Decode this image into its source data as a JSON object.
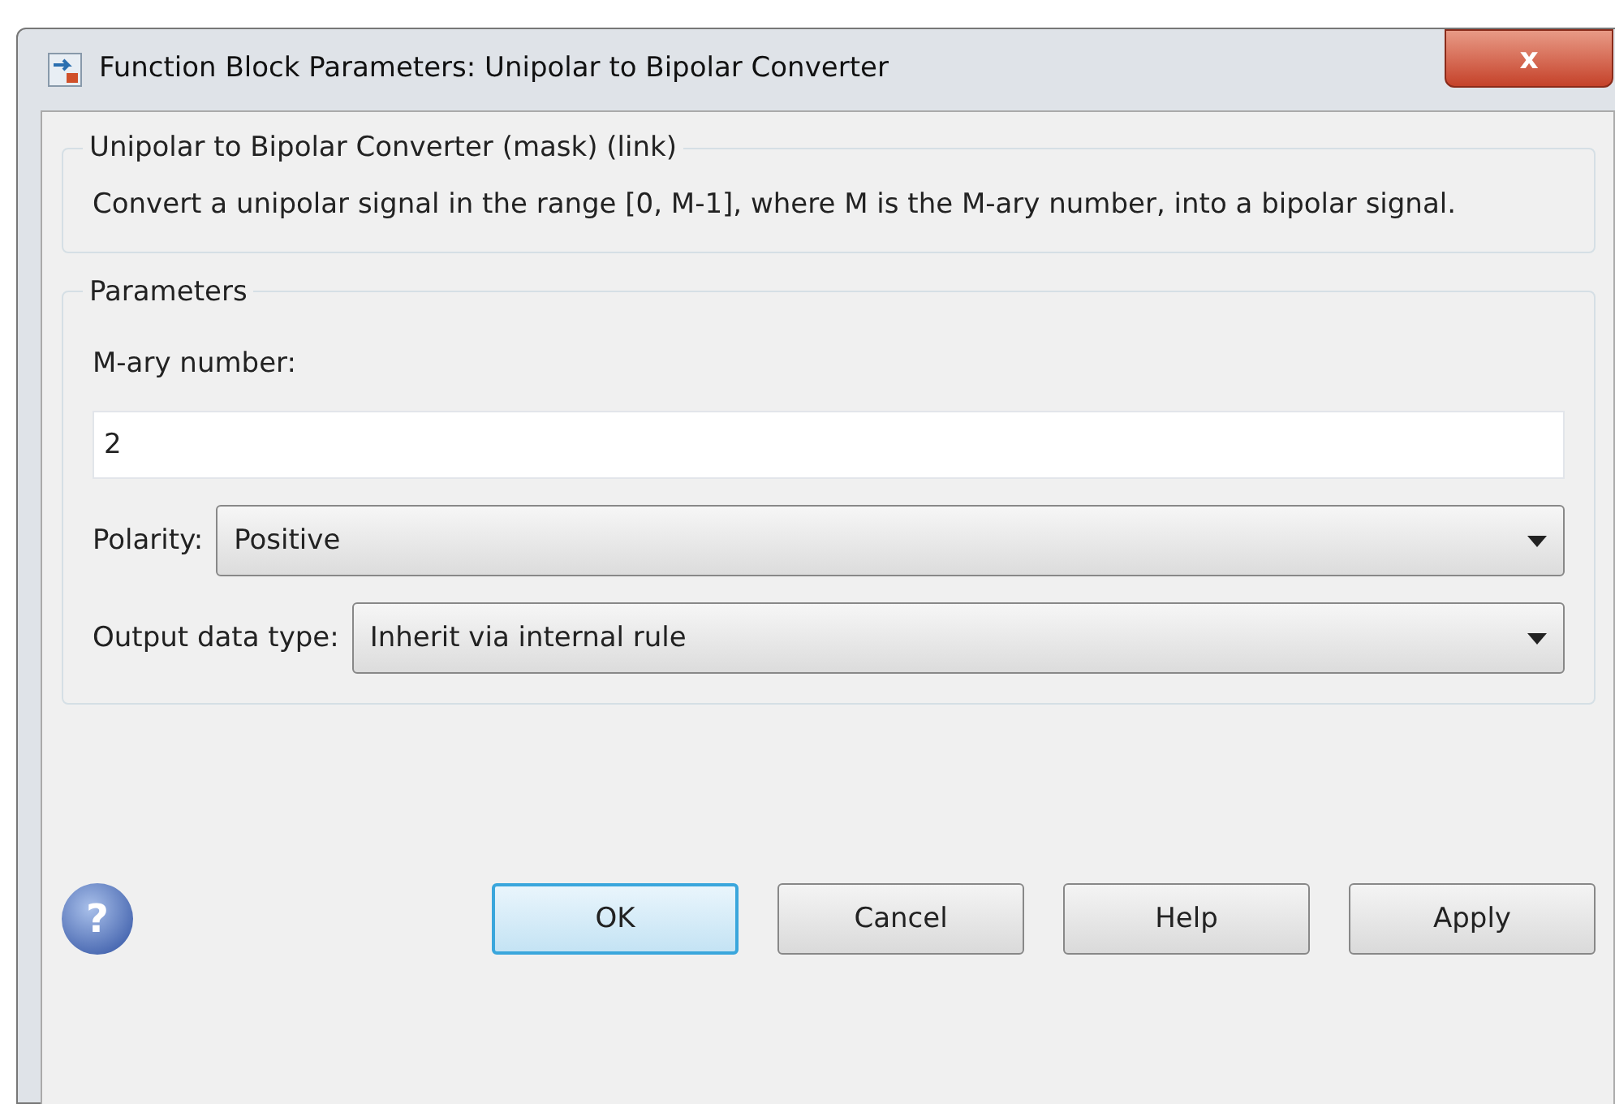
{
  "window": {
    "title": "Function Block Parameters: Unipolar to Bipolar Converter",
    "close": "x"
  },
  "description": {
    "title": "Unipolar to Bipolar Converter (mask) (link)",
    "text": "Convert a unipolar signal in the range [0, M-1], where M is the M-ary number,  into a bipolar signal."
  },
  "parameters": {
    "title": "Parameters",
    "fields": [
      {
        "kind": "text",
        "label": "M-ary number:",
        "value": "2"
      },
      {
        "kind": "select",
        "label": "Polarity:",
        "value": "Positive"
      },
      {
        "kind": "select",
        "label": "Output data type:",
        "value": "Inherit via internal rule"
      }
    ]
  },
  "help_icon": "?",
  "buttons": [
    {
      "label": "OK",
      "default": true
    },
    {
      "label": "Cancel",
      "default": false
    },
    {
      "label": "Help",
      "default": false
    },
    {
      "label": "Apply",
      "default": false
    }
  ]
}
